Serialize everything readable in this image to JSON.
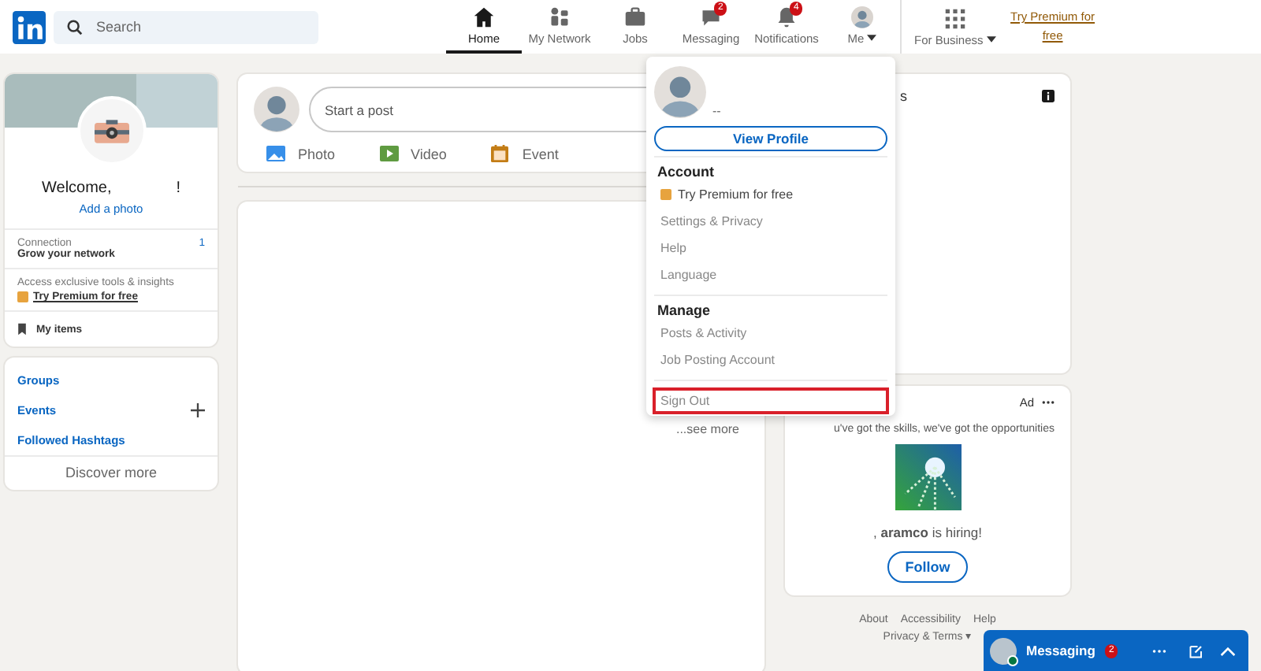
{
  "nav": {
    "search": {
      "placeholder": "Search"
    },
    "items": [
      {
        "label": "Home",
        "selected": true
      },
      {
        "label": "My Network",
        "selected": false
      },
      {
        "label": "Jobs",
        "selected": false
      },
      {
        "label": "Messaging",
        "badge": "2",
        "selected": false
      },
      {
        "label": "Notifications",
        "badge": "4",
        "selected": false
      },
      {
        "label": "Me",
        "selected": false
      }
    ],
    "business": "For Business",
    "premium": "Try Premium for free"
  },
  "profile_card": {
    "welcome": "Welcome,",
    "exclaim": "!",
    "add_photo": "Add a photo",
    "connection_label": "Connection",
    "connection_count": "1",
    "grow": "Grow your network",
    "access": "Access exclusive tools & insights",
    "premium": "Try Premium for free",
    "my_items": "My items"
  },
  "links_card": {
    "links": [
      "Groups",
      "Events",
      "Followed Hashtags"
    ],
    "discover": "Discover more"
  },
  "share_box": {
    "placeholder": "Start a post",
    "actions": [
      {
        "label": "Photo"
      },
      {
        "label": "Video"
      },
      {
        "label": "Event"
      }
    ]
  },
  "feed": {
    "see_more": "...see more"
  },
  "news_card": {
    "title_fragment": "s"
  },
  "ad_card": {
    "ad": "Ad",
    "tagline": "u've got the skills, we've got the opportunities",
    "hiring": ", **aramco** is hiring!",
    "follow": "Follow"
  },
  "footer": {
    "row_1": [
      "About",
      "Accessibility",
      "Help"
    ],
    "row_2": [
      "Privacy & Terms ▾"
    ]
  },
  "me_menu": {
    "name": "--",
    "view_profile": "View Profile",
    "sections": [
      {
        "title": "Account",
        "items": [
          {
            "label": "Try Premium for free",
            "kind": "premium",
            "highlighted": false
          },
          {
            "label": "Settings & Privacy",
            "kind": "plain",
            "highlighted": false
          },
          {
            "label": "Help",
            "kind": "plain",
            "highlighted": false
          },
          {
            "label": "Language",
            "kind": "plain",
            "highlighted": false
          }
        ]
      },
      {
        "title": "Manage",
        "items": [
          {
            "label": "Posts & Activity",
            "kind": "plain",
            "highlighted": false
          },
          {
            "label": "Job Posting Account",
            "kind": "plain",
            "highlighted": false
          }
        ]
      },
      {
        "items": [
          {
            "label": "Sign Out",
            "kind": "plain",
            "highlighted": true
          }
        ]
      }
    ]
  },
  "messaging_bar": {
    "label": "Messaging",
    "badge": "2"
  }
}
